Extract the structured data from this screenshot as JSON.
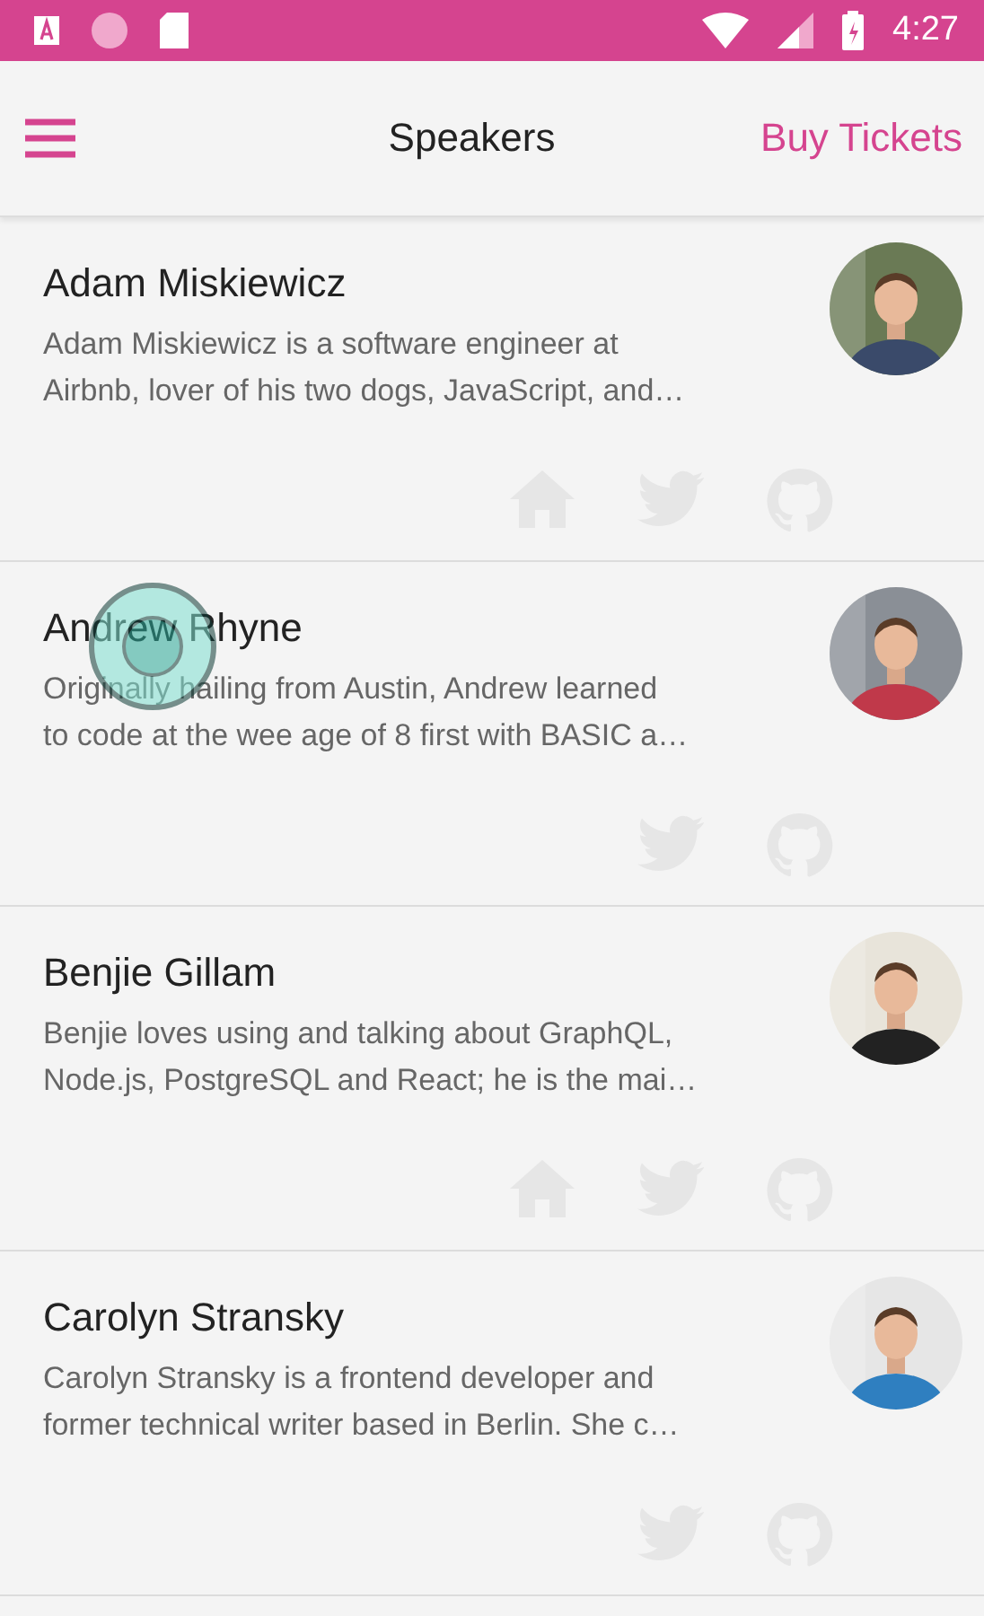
{
  "status_bar": {
    "time": "4:27"
  },
  "header": {
    "title": "Speakers",
    "action": "Buy Tickets"
  },
  "speakers": [
    {
      "name": "Adam Miskiewicz",
      "bio": [
        "Adam Miskiewicz is a software engineer at",
        "Airbnb, lover of his two dogs, JavaScript, and…"
      ],
      "website": true,
      "touched": false
    },
    {
      "name": "Andrew Rhyne",
      "bio": [
        "Originally hailing from Austin, Andrew learned",
        "to code at the wee age of 8 first with BASIC a…"
      ],
      "website": false,
      "touched": true
    },
    {
      "name": "Benjie Gillam",
      "bio": [
        "Benjie loves using and talking about GraphQL,",
        "Node.js, PostgreSQL and React; he is the mai…"
      ],
      "website": true,
      "touched": false
    },
    {
      "name": "Carolyn Stransky",
      "bio": [
        "Carolyn Stransky is a frontend developer and",
        "former technical writer based in Berlin. She c…"
      ],
      "website": false,
      "touched": false
    }
  ]
}
